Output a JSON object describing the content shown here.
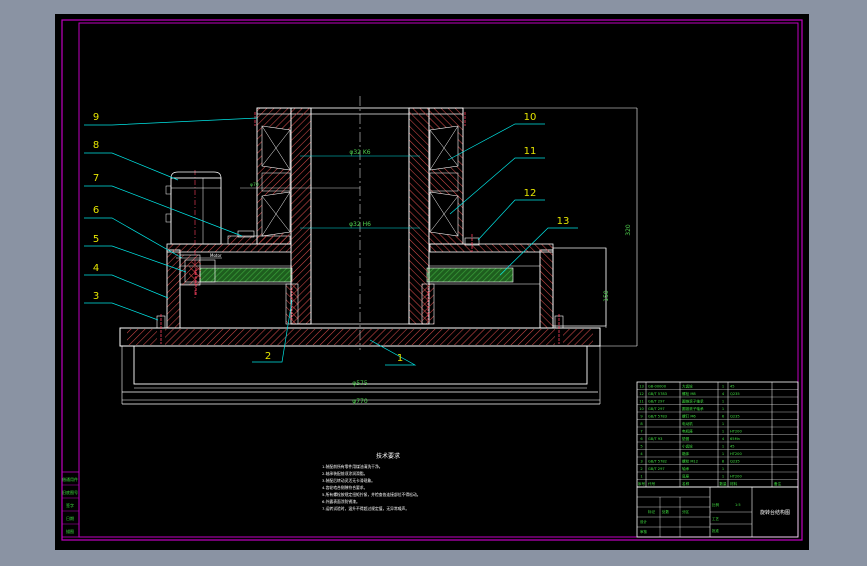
{
  "colors": {
    "background_window": "#8a93a3",
    "sheet": "#000000",
    "frame": "#c000c0",
    "outline": "#ffffff",
    "leader": "#00e5e5",
    "callout_text": "#e6e600",
    "hatch": "#d24a4a",
    "gear": "#2f8a2f",
    "dimension_text": "#4fd24f",
    "table_text": "#40e040",
    "bolt": "#ff4060"
  },
  "callouts": [
    "1",
    "2",
    "3",
    "4",
    "5",
    "6",
    "7",
    "8",
    "9",
    "10",
    "11",
    "12",
    "13"
  ],
  "dimensions": {
    "shaft_upper": "φ32 K6",
    "shaft_lower": "φ32 H6",
    "small": "φ70",
    "base_inner": "φ575",
    "base_outer": "φ770",
    "height_total": "320",
    "height_lower": "150",
    "motor_label": "Motor"
  },
  "notes": {
    "title": "技术要求",
    "lines": [
      "1.装配前所有零件用煤油清洗干净。",
      "2.轴承装配前须涂润滑脂。",
      "3.装配后转动灵活无卡滞现象。",
      "4.齿轮啮合侧隙符合要求。",
      "5.所有螺栓按规定扭矩拧紧，并检查各连接部位不得松动。",
      "6.外露表面涂防锈漆。",
      "7.运转试验时，温升不得超过规定值，无异常噪声。"
    ]
  },
  "bom_rows": [
    [
      "13",
      "GB-00000",
      "大齿轮",
      "1",
      "45",
      ""
    ],
    [
      "12",
      "GB/T 5783",
      "螺栓 M8",
      "4",
      "Q235",
      ""
    ],
    [
      "11",
      "GB/T 297",
      "圆锥滚子轴承",
      "1",
      "",
      ""
    ],
    [
      "10",
      "GB/T 297",
      "圆锥滚子轴承",
      "1",
      "",
      ""
    ],
    [
      "9",
      "GB/T 5783",
      "螺钉 M6",
      "6",
      "Q235",
      ""
    ],
    [
      "8",
      "",
      "电动机",
      "1",
      "",
      ""
    ],
    [
      "7",
      "",
      "电机座",
      "1",
      "HT200",
      ""
    ],
    [
      "6",
      "GB/T 93",
      "垫圈",
      "4",
      "65Mn",
      ""
    ],
    [
      "5",
      "",
      "小齿轮",
      "1",
      "45",
      ""
    ],
    [
      "4",
      "",
      "箱体",
      "1",
      "HT200",
      ""
    ],
    [
      "3",
      "GB/T 5782",
      "螺栓 M12",
      "8",
      "Q235",
      ""
    ],
    [
      "2",
      "GB/T 297",
      "轴承",
      "1",
      "",
      ""
    ],
    [
      "1",
      "",
      "底座",
      "1",
      "HT200",
      ""
    ]
  ],
  "bom_header": [
    "序号",
    "代号",
    "名称",
    "数量",
    "材料",
    "备注"
  ],
  "title_block": {
    "drawing_title": "旋转台结构图",
    "labels": [
      "标记",
      "处数",
      "分区",
      "更改文件号",
      "签名",
      "年月日"
    ],
    "roles": [
      "设计",
      "审核",
      "工艺",
      "批准"
    ],
    "scale_label": "比例",
    "scale_value": "1:5"
  },
  "side_strip": [
    "借通用件",
    "旧底图号",
    "签字",
    "日期",
    "描图"
  ]
}
